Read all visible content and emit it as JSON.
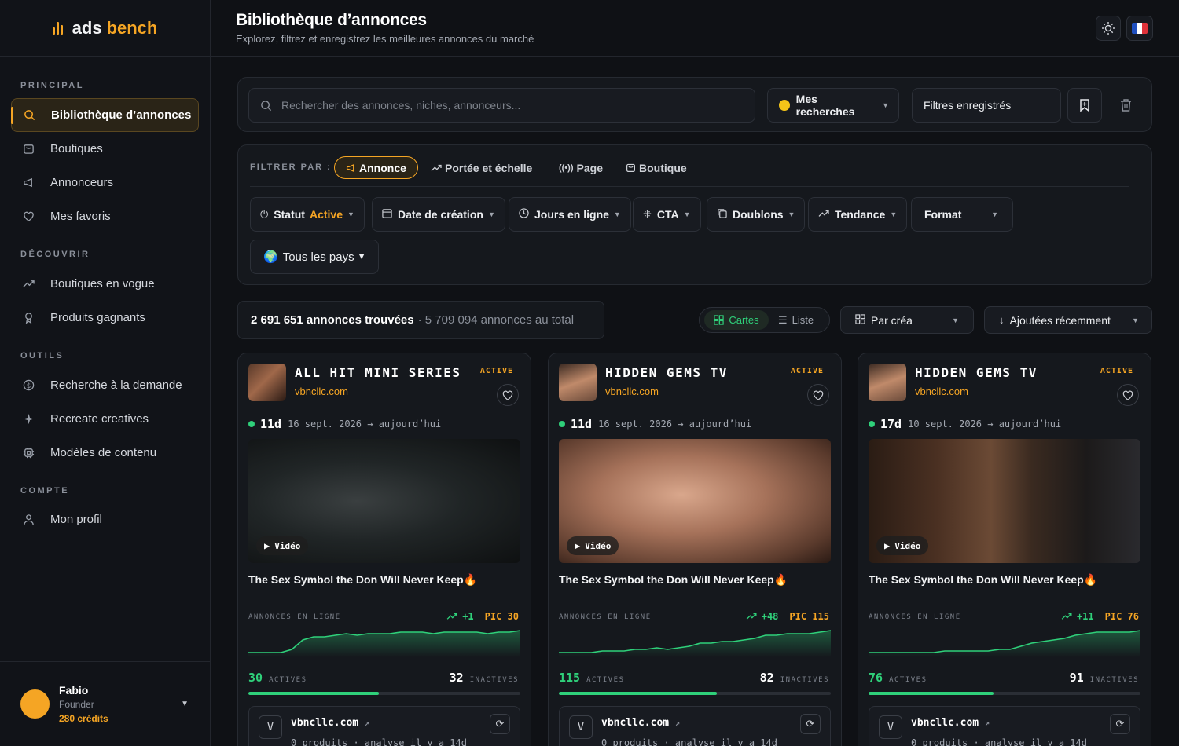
{
  "brand": {
    "part1": "ads",
    "part2": "bench"
  },
  "sidebar": {
    "sections": [
      "PRINCIPAL",
      "DÉCOUVRIR",
      "OUTILS",
      "COMPTE"
    ],
    "items": [
      {
        "label": "Bibliothèque d’annonces",
        "icon": "search-icon"
      },
      {
        "label": "Boutiques",
        "icon": "store-icon"
      },
      {
        "label": "Annonceurs",
        "icon": "megaphone-icon"
      },
      {
        "label": "Mes favoris",
        "icon": "heart-icon"
      },
      {
        "label": "Boutiques en vogue",
        "icon": "trending-icon"
      },
      {
        "label": "Produits gagnants",
        "icon": "trophy-icon"
      },
      {
        "label": "Recherche à la demande",
        "icon": "coin-icon"
      },
      {
        "label": "Recreate creatives",
        "icon": "sparkle-icon"
      },
      {
        "label": "Modèles de contenu",
        "icon": "cpu-icon"
      },
      {
        "label": "Mon profil",
        "icon": "user-icon"
      }
    ]
  },
  "user": {
    "name": "Fabio",
    "role": "Founder",
    "credits": "280 crédits"
  },
  "header": {
    "title": "Bibliothèque d’annonces",
    "subtitle": "Explorez, filtrez et enregistrez les meilleures annonces du marché"
  },
  "search": {
    "placeholder": "Rechercher des annonces, niches, annonceurs...",
    "my_searches": "Mes recherches",
    "saved_filters": "Filtres enregistrés"
  },
  "filters": {
    "label": "FILTRER PAR :",
    "tabs": [
      "Annonce",
      "Portée et échelle",
      "Page",
      "Boutique"
    ],
    "status_label": "Statut",
    "status_value": "Active",
    "chips": [
      "Date de création",
      "Jours en ligne",
      "CTA",
      "Doublons",
      "Tendance",
      "Format"
    ],
    "countries": "Tous les pays"
  },
  "results": {
    "found": "2 691 651 annonces trouvées",
    "total": "· 5 709 094 annonces au total"
  },
  "view": {
    "cards": "Cartes",
    "list": "Liste",
    "group": "Par créa",
    "sort": "Ajoutées récemment"
  },
  "labels": {
    "video": "Vidéo",
    "online": "ANNONCES EN LIGNE",
    "actives": "ACTIVES",
    "inactives": "INACTIVES",
    "badge": "ACTIVE"
  },
  "colors": {
    "accent": "#f5a524",
    "green": "#2fd07a",
    "bg": "#0f1115"
  },
  "cards": [
    {
      "name": "ALL HIT MINI SERIES",
      "domain": "vbncllc.com",
      "days": "11d",
      "dates": "16 sept. 2026 → aujourd’hui",
      "text": "The Sex Symbol the Don Will Never Keep🔥",
      "trend": "+1",
      "peak": "PIC 30",
      "actives": "30",
      "inactives": "32",
      "active_ratio": 0.48,
      "spark": [
        2,
        2,
        2,
        2,
        4,
        10,
        12,
        12,
        13,
        14,
        13,
        14,
        14,
        14,
        15,
        15,
        15,
        14,
        15,
        15,
        15,
        15,
        14,
        15,
        15,
        16
      ],
      "shop": "vbncllc.com",
      "shop_meta": "0 produits · analyse il y a 14d",
      "shop_initial": "V"
    },
    {
      "name": "HIDDEN GEMS TV",
      "domain": "vbncllc.com",
      "days": "11d",
      "dates": "16 sept. 2026 → aujourd’hui",
      "text": "The Sex Symbol the Don Will Never Keep🔥",
      "trend": "+48",
      "peak": "PIC 115",
      "actives": "115",
      "inactives": "82",
      "active_ratio": 0.58,
      "spark": [
        2,
        2,
        2,
        2,
        3,
        3,
        3,
        4,
        4,
        5,
        4,
        5,
        6,
        8,
        8,
        9,
        9,
        10,
        11,
        13,
        13,
        14,
        14,
        14,
        15,
        16
      ],
      "shop": "vbncllc.com",
      "shop_meta": "0 produits · analyse il y a 14d",
      "shop_initial": "V"
    },
    {
      "name": "HIDDEN GEMS TV",
      "domain": "vbncllc.com",
      "days": "17d",
      "dates": "10 sept. 2026 → aujourd’hui",
      "text": "The Sex Symbol the Don Will Never Keep🔥",
      "trend": "+11",
      "peak": "PIC 76",
      "actives": "76",
      "inactives": "91",
      "active_ratio": 0.46,
      "spark": [
        2,
        2,
        2,
        2,
        2,
        2,
        2,
        3,
        3,
        3,
        3,
        3,
        4,
        4,
        6,
        8,
        9,
        10,
        11,
        13,
        14,
        15,
        15,
        15,
        15,
        16
      ],
      "shop": "vbncllc.com",
      "shop_meta": "0 produits · analyse il y a 14d",
      "shop_initial": "V"
    }
  ]
}
